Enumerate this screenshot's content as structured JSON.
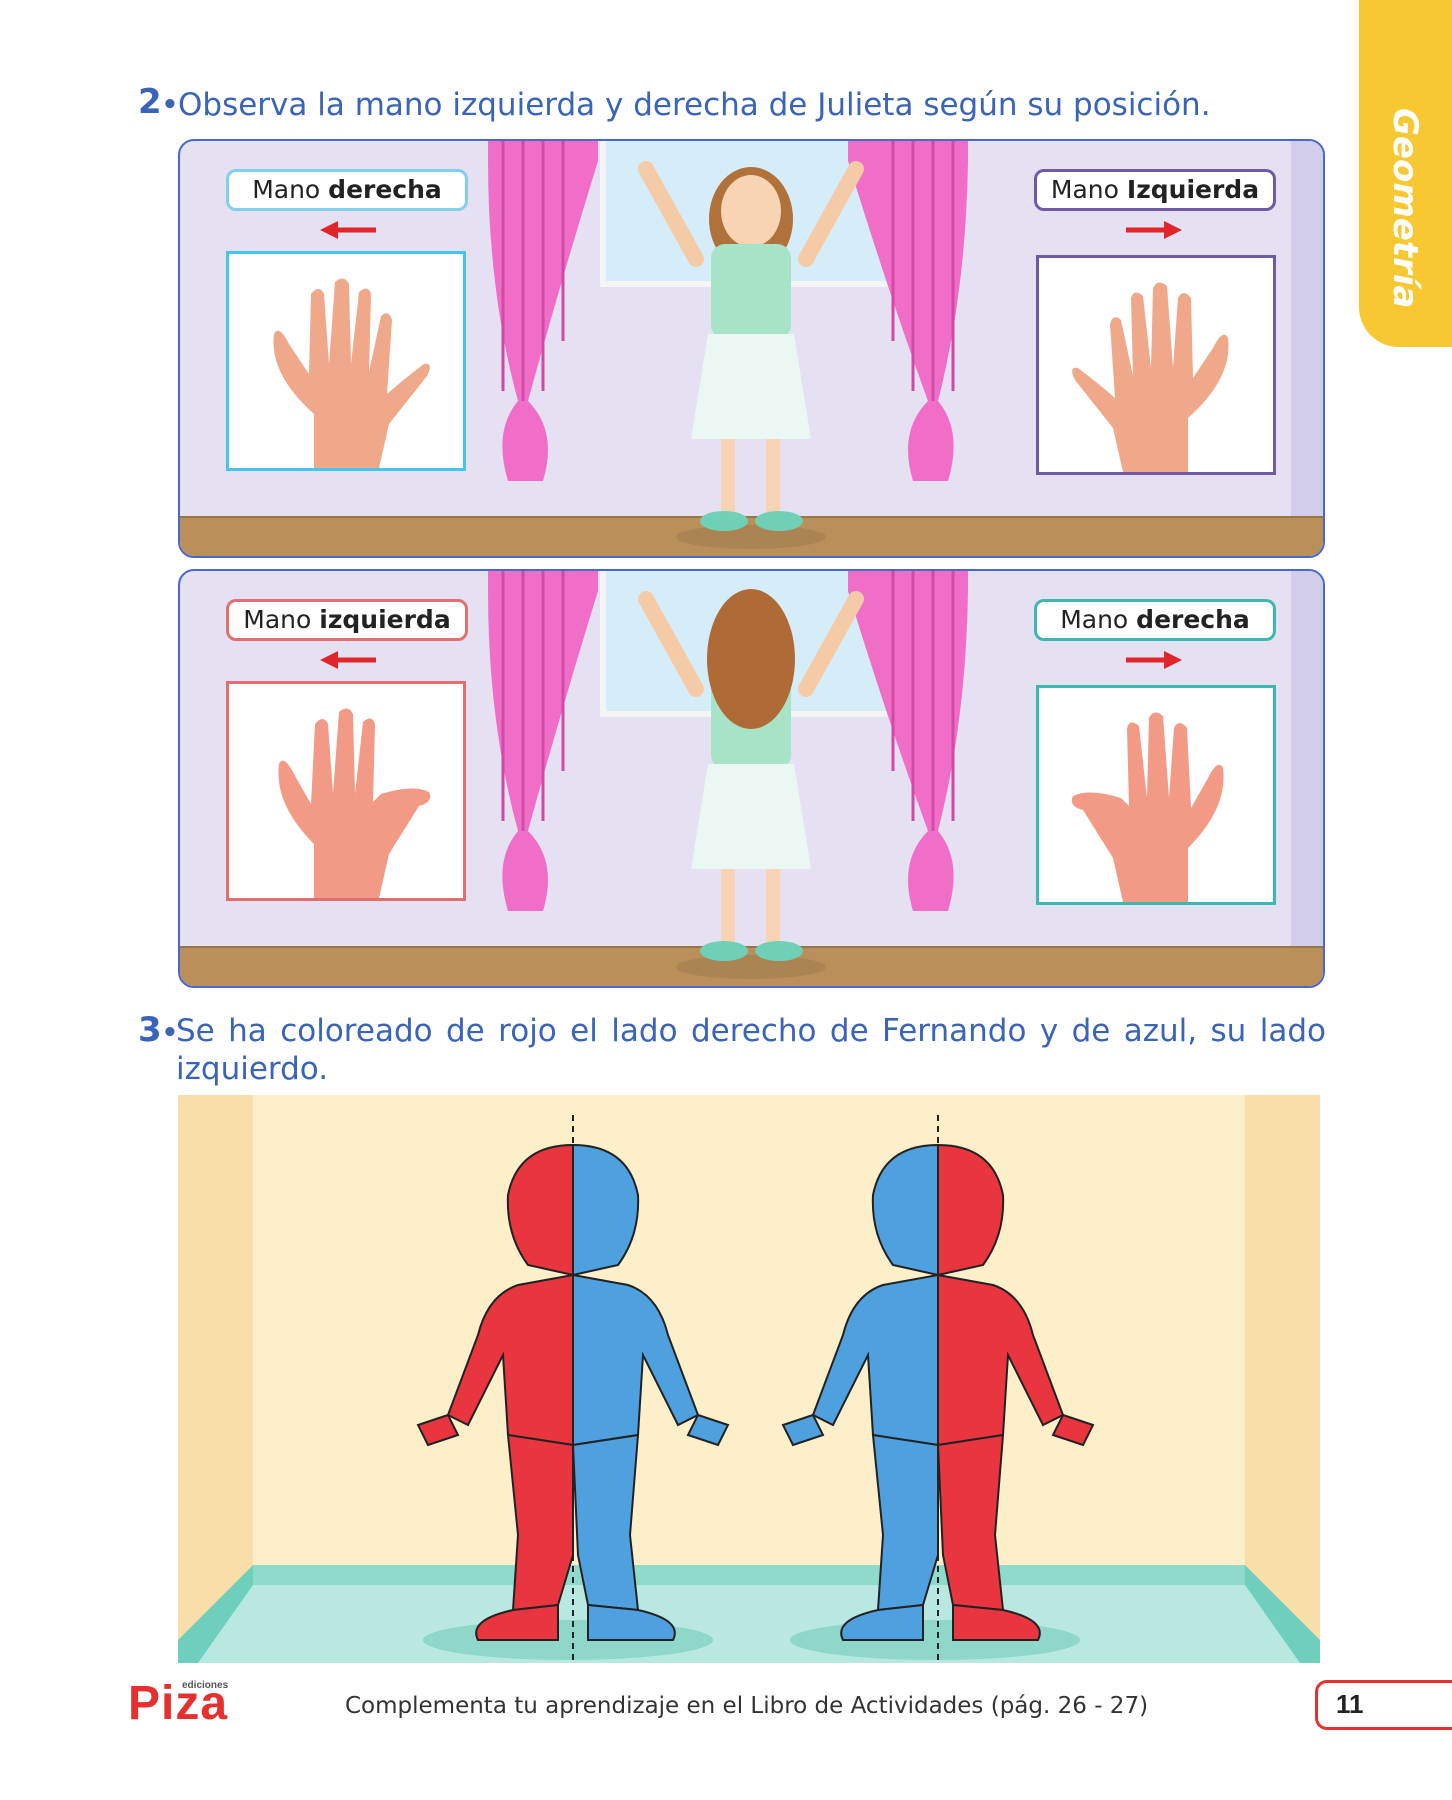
{
  "side_tab": {
    "label": "Geometría"
  },
  "question2": {
    "number": "2",
    "text": "Observa la mano izquierda y derecha de Julieta según su posición.",
    "panel_front": {
      "left_label_prefix": "Mano ",
      "left_label_bold": "derecha",
      "right_label_prefix": "Mano ",
      "right_label_bold": "Izquierda"
    },
    "panel_back": {
      "left_label_prefix": "Mano ",
      "left_label_bold": "izquierda",
      "right_label_prefix": "Mano ",
      "right_label_bold": "derecha"
    }
  },
  "question3": {
    "number": "3",
    "text": "Se ha coloreado de rojo el lado derecho de Fernando y de azul, su lado izquierdo."
  },
  "footer": {
    "logo": "Piza",
    "logo_small": "ediciones",
    "text": "Complementa tu aprendizaje en el Libro de Actividades (pág. 26 - 27)",
    "page_number": "11"
  },
  "colors": {
    "accent_blue": "#3a64b8",
    "red_side": "#e8353f",
    "blue_side": "#4ea0de",
    "tab_yellow": "#f7c832"
  }
}
